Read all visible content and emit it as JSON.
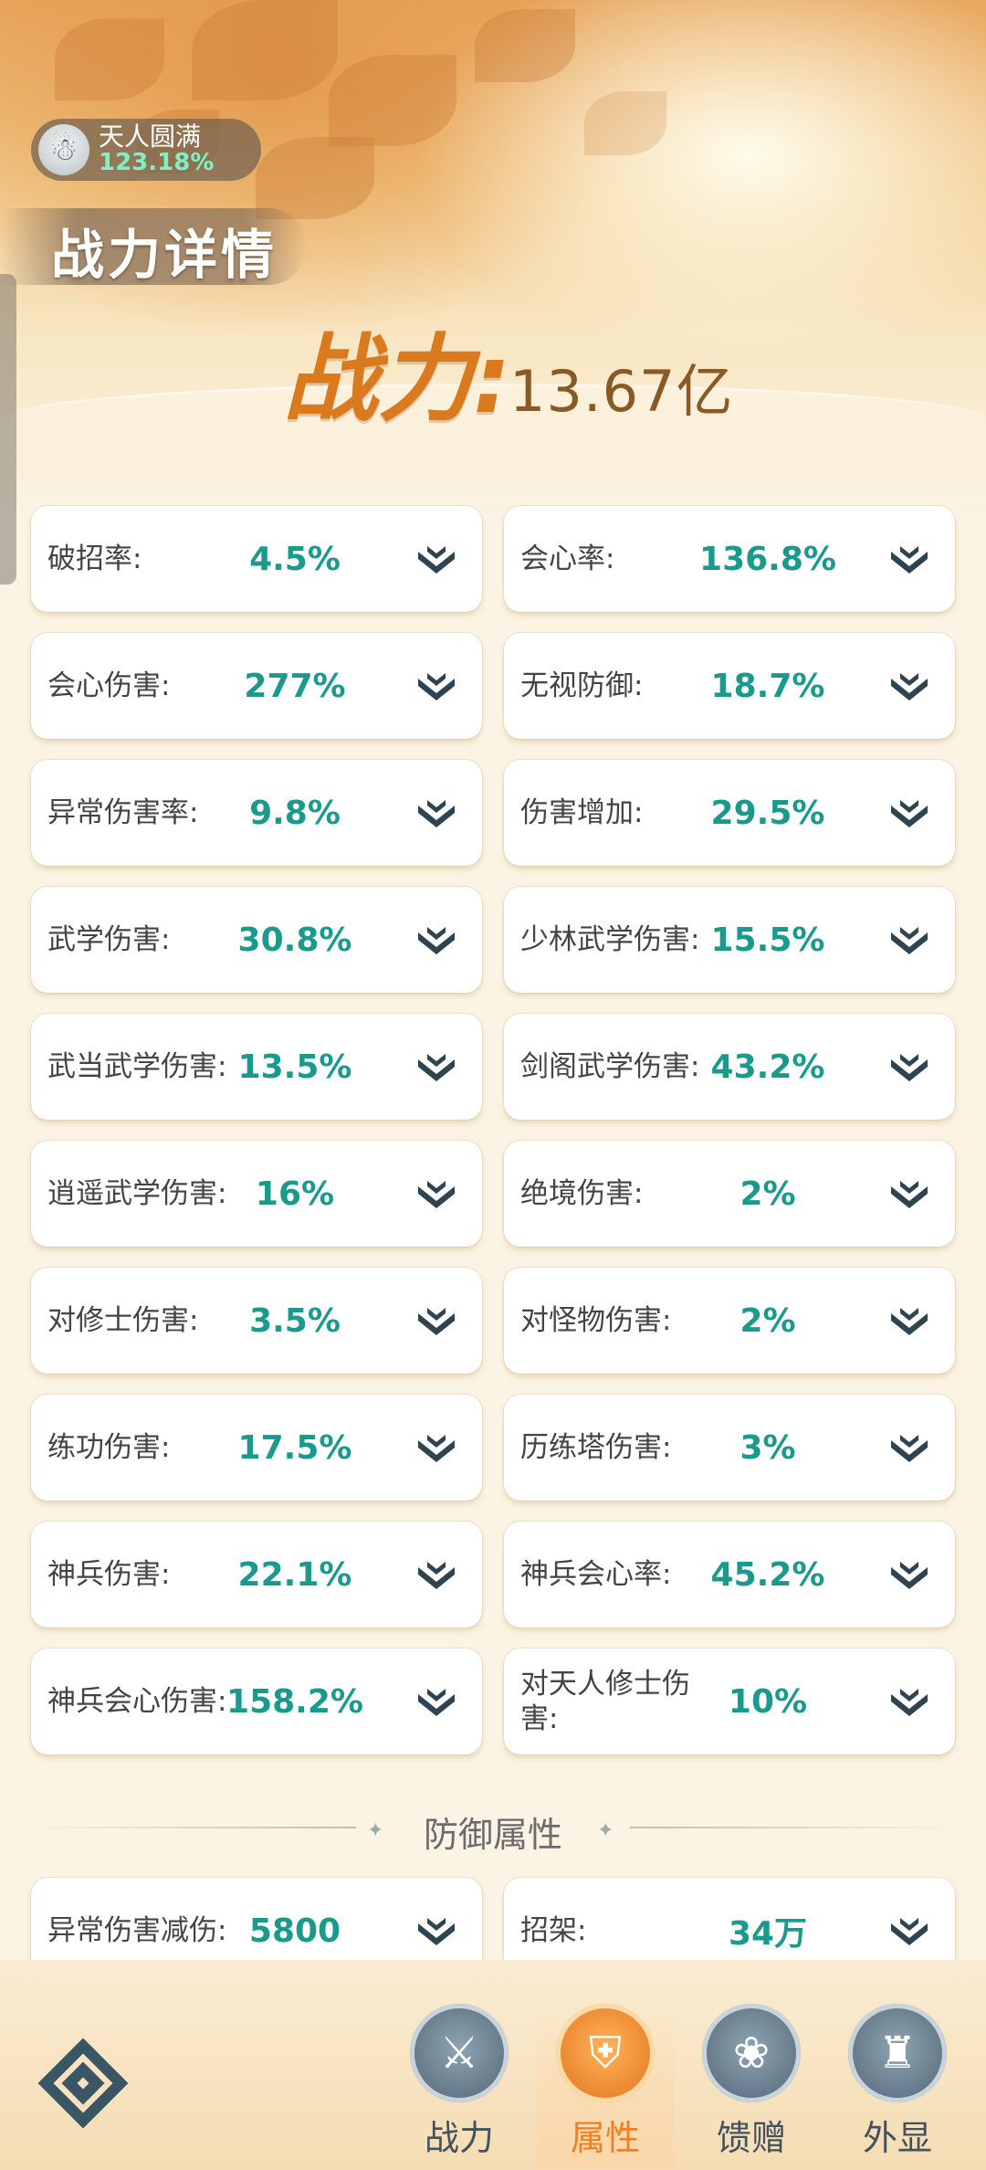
{
  "realm": {
    "name": "天人圆满",
    "percent": "123.18%"
  },
  "page_title": "战力详情",
  "power": {
    "label": "战力:",
    "value": "13.67亿"
  },
  "stats": [
    {
      "label": "破招率:",
      "value": "4.5%"
    },
    {
      "label": "会心率:",
      "value": "136.8%"
    },
    {
      "label": "会心伤害:",
      "value": "277%"
    },
    {
      "label": "无视防御:",
      "value": "18.7%"
    },
    {
      "label": "异常伤害率:",
      "value": "9.8%"
    },
    {
      "label": "伤害增加:",
      "value": "29.5%"
    },
    {
      "label": "武学伤害:",
      "value": "30.8%"
    },
    {
      "label": "少林武学伤害:",
      "value": "15.5%"
    },
    {
      "label": "武当武学伤害:",
      "value": "13.5%"
    },
    {
      "label": "剑阁武学伤害:",
      "value": "43.2%"
    },
    {
      "label": "逍遥武学伤害:",
      "value": "16%"
    },
    {
      "label": "绝境伤害:",
      "value": "2%"
    },
    {
      "label": "对修士伤害:",
      "value": "3.5%"
    },
    {
      "label": "对怪物伤害:",
      "value": "2%"
    },
    {
      "label": "练功伤害:",
      "value": "17.5%"
    },
    {
      "label": "历练塔伤害:",
      "value": "3%"
    },
    {
      "label": "神兵伤害:",
      "value": "22.1%"
    },
    {
      "label": "神兵会心率:",
      "value": "45.2%"
    },
    {
      "label": "神兵会心伤害:",
      "value": "158.2%"
    },
    {
      "label": "对天人修士伤害:",
      "value": "10%"
    }
  ],
  "defense_section": {
    "title": "防御属性"
  },
  "defense_stats": [
    {
      "label": "异常伤害减伤:",
      "value": "5800"
    },
    {
      "label": "招架:",
      "value": "34万"
    }
  ],
  "nav": [
    {
      "label": "战力",
      "icon": "sword-icon"
    },
    {
      "label": "属性",
      "icon": "shield-icon"
    },
    {
      "label": "馈赠",
      "icon": "gift-bag-icon"
    },
    {
      "label": "外显",
      "icon": "castle-icon"
    }
  ],
  "colors": {
    "accent_orange": "#f07f23",
    "value_teal": "#1a9a8c",
    "power_orange": "#d97a1e"
  }
}
